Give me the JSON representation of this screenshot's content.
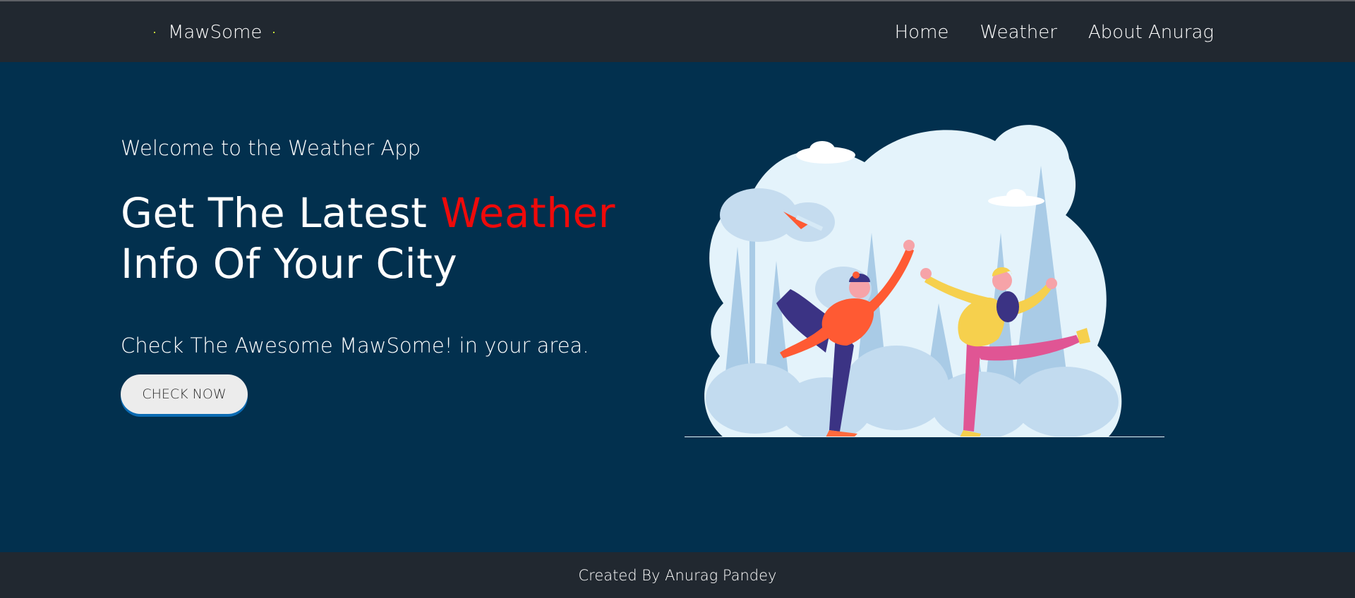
{
  "navbar": {
    "brand": "MawSome",
    "links": [
      "Home",
      "Weather",
      "About Anurag"
    ]
  },
  "hero": {
    "welcome": "Welcome to the Weather App",
    "headline_line1_prefix": "Get The Latest ",
    "headline_accent": "Weather",
    "headline_line2": "Info Of Your City",
    "subtext": "Check The Awesome MawSome! in your area.",
    "cta_label": "CHECK NOW",
    "illustration": "people-dancing-in-snowy-forest-illustration"
  },
  "footer": {
    "credit": "Created By Anurag Pandey"
  },
  "colors": {
    "nav_bg": "#212830",
    "hero_bg": "#02304e",
    "accent": "#ef0a0a",
    "cta_bg": "#ececec",
    "cta_shadow": "#0b6bb3"
  }
}
